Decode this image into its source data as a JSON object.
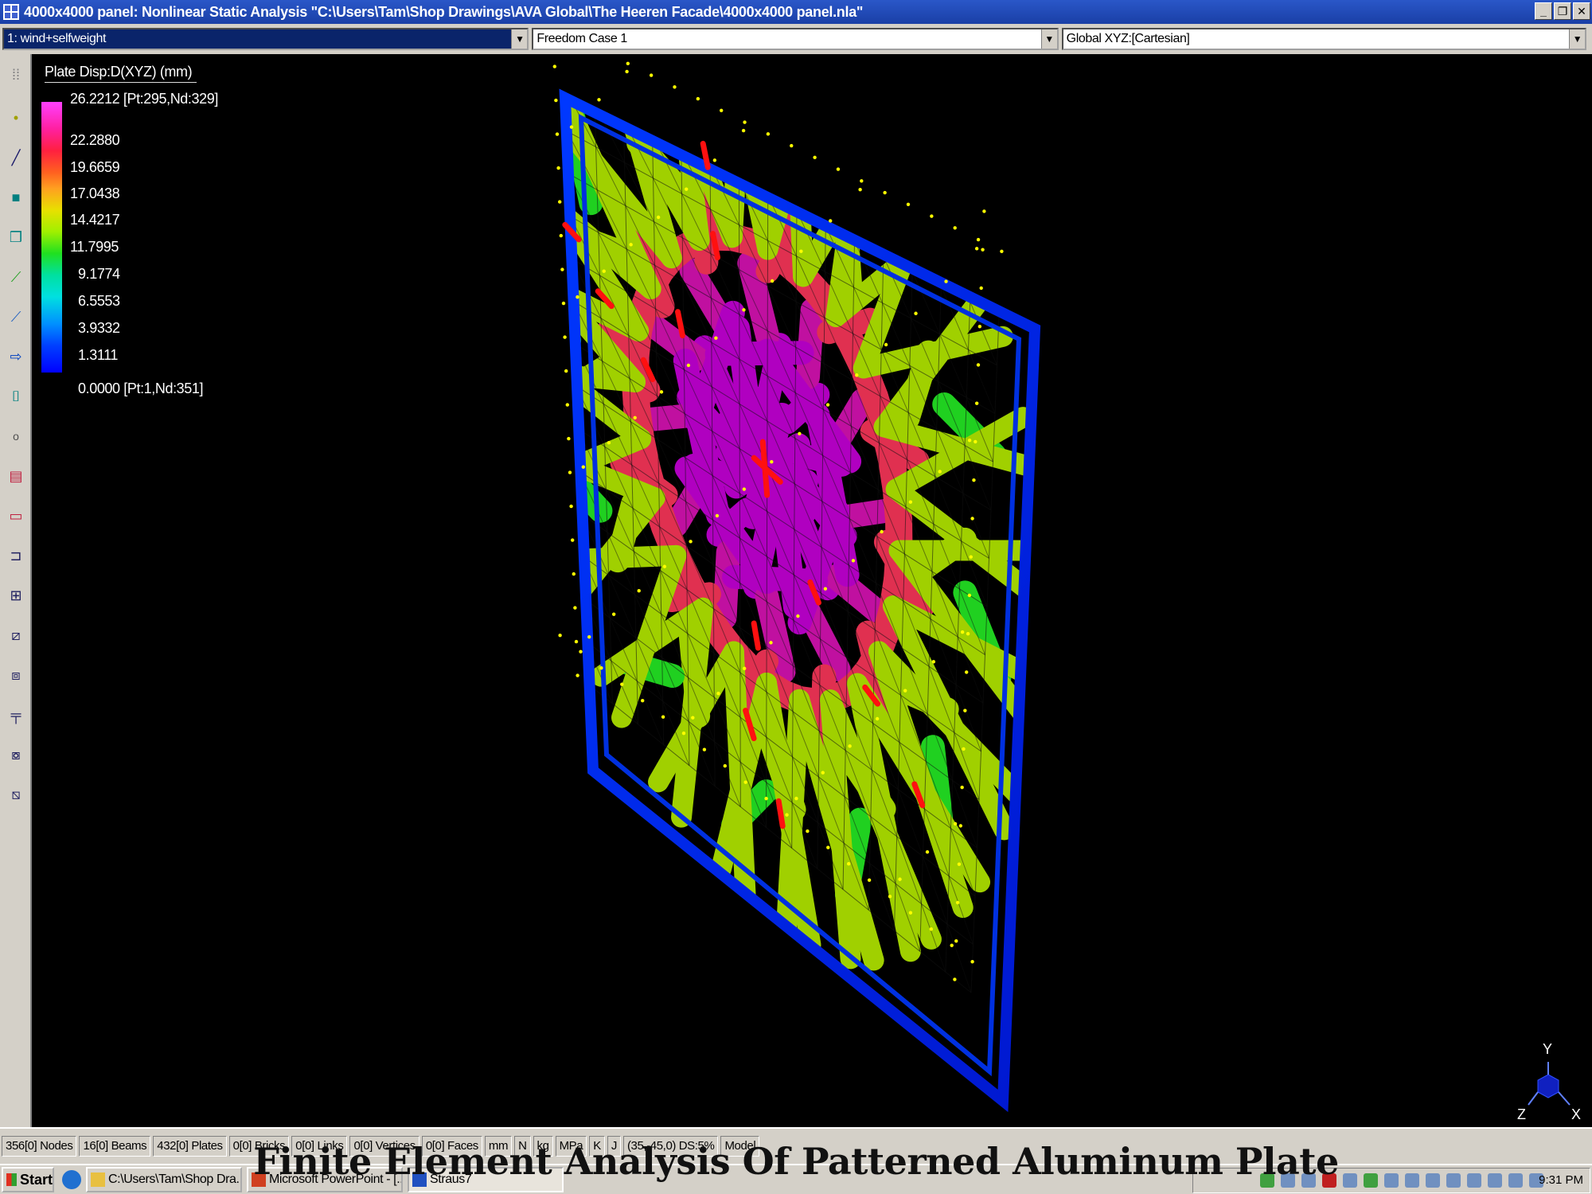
{
  "window": {
    "title": "4000x4000 panel: Nonlinear Static Analysis \"C:\\Users\\Tam\\Shop Drawings\\AVA Global\\The Heeren Facade\\4000x4000 panel.nla\"",
    "minimize": "_",
    "restore": "❐",
    "close": "✕"
  },
  "dropdowns": {
    "load_case": "1: wind+selfweight",
    "freedom_case": "Freedom Case 1",
    "coordinate_system": "Global XYZ:[Cartesian]"
  },
  "legend": {
    "title": "Plate Disp:D(XYZ) (mm)",
    "max_label": "26.2212 [Pt:295,Nd:329]",
    "values": [
      "22.2880",
      "19.6659",
      "17.0438",
      "14.4217",
      "11.7995",
      "9.1774",
      "6.5553",
      "3.9332",
      "1.3111"
    ],
    "min_label": "0.0000 [Pt:1,Nd:351]"
  },
  "triad": {
    "y": "Y",
    "z": "Z",
    "x": "X"
  },
  "status": {
    "nodes": "356[0] Nodes",
    "beams": "16[0] Beams",
    "plates": "432[0] Plates",
    "bricks": "0[0] Bricks",
    "links": "0[0] Links",
    "vertices": "0[0] Vertices",
    "faces": "0[0] Faces",
    "unit_length": "mm",
    "unit_force": "N",
    "unit_mass": "kg",
    "unit_stress": "MPa",
    "unit_temp": "K",
    "unit_energy": "J",
    "view_info": "(35,-45,0) DS:5%",
    "mode": "Model"
  },
  "taskbar": {
    "start": "Start",
    "tasks": [
      "C:\\Users\\Tam\\Shop Dra...",
      "Microsoft PowerPoint - [...",
      "Straus7"
    ],
    "clock": "9:31 PM"
  },
  "caption": "Finite Element Analysis Of Patterned Aluminum Plate"
}
